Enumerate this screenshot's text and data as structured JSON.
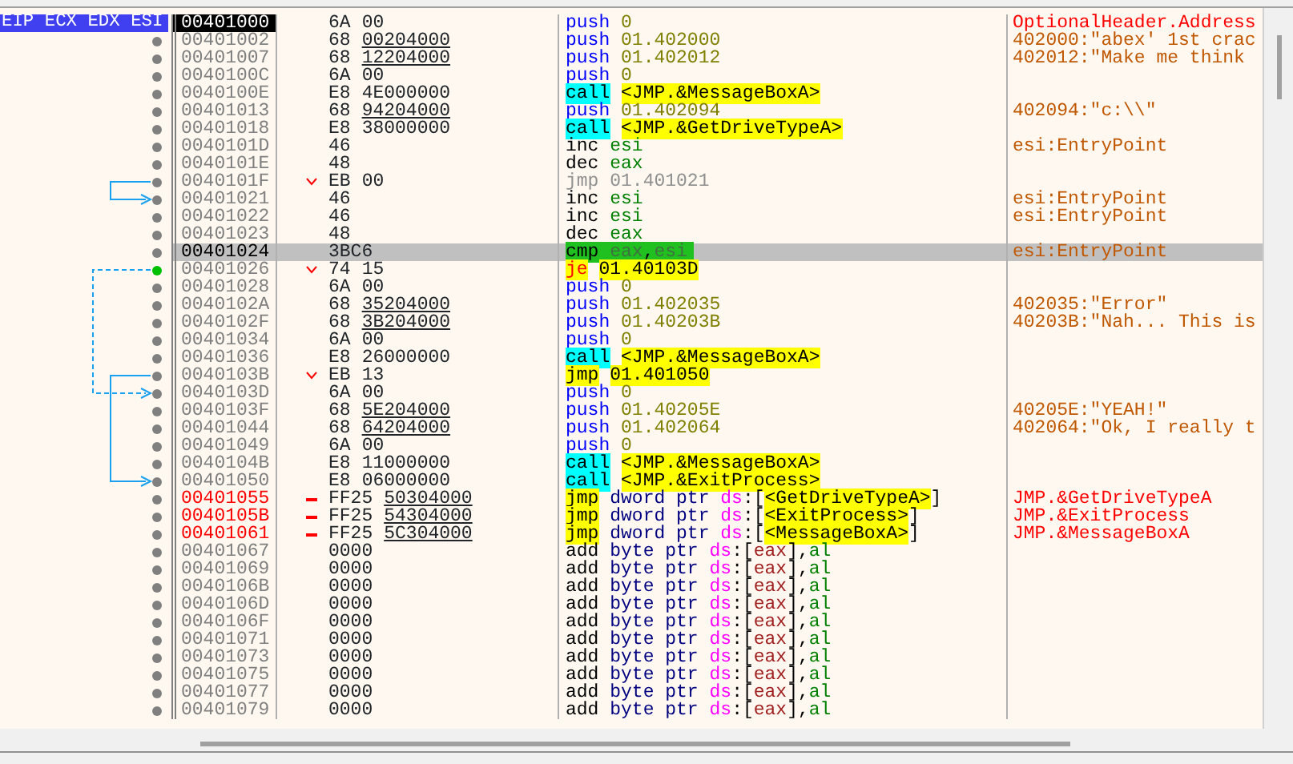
{
  "rows": [
    {
      "address": {
        "text": "00401000",
        "kind": "eip"
      },
      "selected": false,
      "register_tags": "EIP ECX EDX ESI",
      "opcode": "6A",
      "operand": "00",
      "underlined": false,
      "mnemonic": {
        "text": "push",
        "kind": "push"
      },
      "operands": [
        {
          "text": "0",
          "kind": "num"
        }
      ],
      "highlight": false,
      "comment": {
        "text": "OptionalHeader.Address",
        "kind": "symbol"
      }
    },
    {
      "address": {
        "text": "00401002",
        "kind": "normal"
      },
      "selected": false,
      "dot": {
        "color": "#808080"
      },
      "opcode": "68",
      "operand": "00204000",
      "underlined": true,
      "mnemonic": {
        "text": "push",
        "kind": "push"
      },
      "operands": [
        {
          "text": "01.402000",
          "kind": "num"
        }
      ],
      "highlight": false,
      "comment": {
        "text": "402000:\"abex' 1st crac",
        "kind": "string"
      }
    },
    {
      "address": {
        "text": "00401007",
        "kind": "normal"
      },
      "selected": false,
      "dot": {
        "color": "#808080"
      },
      "opcode": "68",
      "operand": "12204000",
      "underlined": true,
      "mnemonic": {
        "text": "push",
        "kind": "push"
      },
      "operands": [
        {
          "text": "01.402012",
          "kind": "num"
        }
      ],
      "highlight": false,
      "comment": {
        "text": "402012:\"Make me think",
        "kind": "string"
      }
    },
    {
      "address": {
        "text": "0040100C",
        "kind": "normal"
      },
      "selected": false,
      "dot": {
        "color": "#808080"
      },
      "opcode": "6A",
      "operand": "00",
      "underlined": false,
      "mnemonic": {
        "text": "push",
        "kind": "push"
      },
      "operands": [
        {
          "text": "0",
          "kind": "num"
        }
      ],
      "highlight": false
    },
    {
      "address": {
        "text": "0040100E",
        "kind": "normal"
      },
      "selected": false,
      "dot": {
        "color": "#808080"
      },
      "opcode": "E8",
      "operand": "4E000000",
      "underlined": false,
      "mnemonic": {
        "text": "call",
        "kind": "call"
      },
      "operands": [
        {
          "text": "<JMP.&MessageBoxA>",
          "kind": "label"
        }
      ],
      "highlight": false
    },
    {
      "address": {
        "text": "00401013",
        "kind": "normal"
      },
      "selected": false,
      "dot": {
        "color": "#808080"
      },
      "opcode": "68",
      "operand": "94204000",
      "underlined": true,
      "mnemonic": {
        "text": "push",
        "kind": "push"
      },
      "operands": [
        {
          "text": "01.402094",
          "kind": "num"
        }
      ],
      "highlight": false,
      "comment": {
        "text": "402094:\"c:\\\\\"",
        "kind": "string"
      }
    },
    {
      "address": {
        "text": "00401018",
        "kind": "normal"
      },
      "selected": false,
      "dot": {
        "color": "#808080"
      },
      "opcode": "E8",
      "operand": "38000000",
      "underlined": false,
      "mnemonic": {
        "text": "call",
        "kind": "call"
      },
      "operands": [
        {
          "text": "<JMP.&GetDriveTypeA>",
          "kind": "label"
        }
      ],
      "highlight": false
    },
    {
      "address": {
        "text": "0040101D",
        "kind": "normal"
      },
      "selected": false,
      "dot": {
        "color": "#808080"
      },
      "opcode": "46",
      "mnemonic": {
        "text": "inc",
        "kind": "plain"
      },
      "operands": [
        {
          "text": "esi",
          "kind": "reg"
        }
      ],
      "highlight": false,
      "comment": {
        "text": "esi:EntryPoint",
        "kind": "string"
      }
    },
    {
      "address": {
        "text": "0040101E",
        "kind": "normal"
      },
      "selected": false,
      "dot": {
        "color": "#808080"
      },
      "opcode": "48",
      "mnemonic": {
        "text": "dec",
        "kind": "plain"
      },
      "operands": [
        {
          "text": "eax",
          "kind": "reg"
        }
      ],
      "highlight": false
    },
    {
      "address": {
        "text": "0040101F",
        "kind": "normal"
      },
      "selected": false,
      "dot": {
        "color": "#808080"
      },
      "branch": {
        "kind": "jump"
      },
      "arrow": {
        "kind": "start"
      },
      "opcode": "EB",
      "operand": "00",
      "underlined": false,
      "mnemonic": {
        "text": "jmp",
        "kind": "dim"
      },
      "operands": [
        {
          "text": "01.401021",
          "kind": "dim"
        }
      ],
      "highlight": false
    },
    {
      "address": {
        "text": "00401021",
        "kind": "normal"
      },
      "selected": false,
      "dot": {
        "color": "#808080"
      },
      "arrow": {
        "kind": "end"
      },
      "opcode": "46",
      "mnemonic": {
        "text": "inc",
        "kind": "plain"
      },
      "operands": [
        {
          "text": "esi",
          "kind": "reg"
        }
      ],
      "highlight": false,
      "comment": {
        "text": "esi:EntryPoint",
        "kind": "string"
      }
    },
    {
      "address": {
        "text": "00401022",
        "kind": "normal"
      },
      "selected": false,
      "dot": {
        "color": "#808080"
      },
      "opcode": "46",
      "mnemonic": {
        "text": "inc",
        "kind": "plain"
      },
      "operands": [
        {
          "text": "esi",
          "kind": "reg"
        }
      ],
      "highlight": false,
      "comment": {
        "text": "esi:EntryPoint",
        "kind": "string"
      }
    },
    {
      "address": {
        "text": "00401023",
        "kind": "normal"
      },
      "selected": false,
      "dot": {
        "color": "#808080"
      },
      "opcode": "48",
      "mnemonic": {
        "text": "dec",
        "kind": "plain"
      },
      "operands": [
        {
          "text": "eax",
          "kind": "reg"
        }
      ],
      "highlight": false
    },
    {
      "address": {
        "text": "00401024",
        "kind": "normal"
      },
      "selected": true,
      "dot": {
        "color": "#808080"
      },
      "opcode": "3BC6",
      "mnemonic": {
        "text": "cmp",
        "kind": "plain"
      },
      "operands": [
        {
          "text": "eax",
          "kind": "reg"
        },
        {
          "text": ",",
          "kind": "punct"
        },
        {
          "text": "esi",
          "kind": "reg"
        }
      ],
      "highlight": true,
      "comment": {
        "text": "esi:EntryPoint",
        "kind": "string"
      }
    },
    {
      "address": {
        "text": "00401026",
        "kind": "normal"
      },
      "selected": false,
      "dot": {
        "color": "#00c000"
      },
      "branch": {
        "kind": "jump"
      },
      "arrow": {
        "kind": "dashstart"
      },
      "opcode": "74",
      "operand": "15",
      "underlined": false,
      "mnemonic": {
        "text": "je",
        "kind": "jcc"
      },
      "operands": [
        {
          "text": "01.40103D",
          "kind": "target"
        }
      ],
      "highlight": false
    },
    {
      "address": {
        "text": "00401028",
        "kind": "normal"
      },
      "selected": false,
      "dot": {
        "color": "#808080"
      },
      "opcode": "6A",
      "operand": "00",
      "underlined": false,
      "mnemonic": {
        "text": "push",
        "kind": "push"
      },
      "operands": [
        {
          "text": "0",
          "kind": "num"
        }
      ],
      "highlight": false
    },
    {
      "address": {
        "text": "0040102A",
        "kind": "normal"
      },
      "selected": false,
      "dot": {
        "color": "#808080"
      },
      "opcode": "68",
      "operand": "35204000",
      "underlined": true,
      "mnemonic": {
        "text": "push",
        "kind": "push"
      },
      "operands": [
        {
          "text": "01.402035",
          "kind": "num"
        }
      ],
      "highlight": false,
      "comment": {
        "text": "402035:\"Error\"",
        "kind": "string"
      }
    },
    {
      "address": {
        "text": "0040102F",
        "kind": "normal"
      },
      "selected": false,
      "dot": {
        "color": "#808080"
      },
      "opcode": "68",
      "operand": "3B204000",
      "underlined": true,
      "mnemonic": {
        "text": "push",
        "kind": "push"
      },
      "operands": [
        {
          "text": "01.40203B",
          "kind": "num"
        }
      ],
      "highlight": false,
      "comment": {
        "text": "40203B:\"Nah... This is",
        "kind": "string"
      }
    },
    {
      "address": {
        "text": "00401034",
        "kind": "normal"
      },
      "selected": false,
      "dot": {
        "color": "#808080"
      },
      "opcode": "6A",
      "operand": "00",
      "underlined": false,
      "mnemonic": {
        "text": "push",
        "kind": "push"
      },
      "operands": [
        {
          "text": "0",
          "kind": "num"
        }
      ],
      "highlight": false
    },
    {
      "address": {
        "text": "00401036",
        "kind": "normal"
      },
      "selected": false,
      "dot": {
        "color": "#808080"
      },
      "opcode": "E8",
      "operand": "26000000",
      "underlined": false,
      "mnemonic": {
        "text": "call",
        "kind": "call"
      },
      "operands": [
        {
          "text": "<JMP.&MessageBoxA>",
          "kind": "label"
        }
      ],
      "highlight": false
    },
    {
      "address": {
        "text": "0040103B",
        "kind": "normal"
      },
      "selected": false,
      "dot": {
        "color": "#808080"
      },
      "branch": {
        "kind": "jump"
      },
      "arrow": {
        "kind": "start"
      },
      "opcode": "EB",
      "operand": "13",
      "underlined": false,
      "mnemonic": {
        "text": "jmp",
        "kind": "jmp"
      },
      "operands": [
        {
          "text": "01.401050",
          "kind": "target"
        }
      ],
      "highlight": false
    },
    {
      "address": {
        "text": "0040103D",
        "kind": "normal"
      },
      "selected": false,
      "dot": {
        "color": "#808080"
      },
      "arrow": {
        "kind": "dashend"
      },
      "opcode": "6A",
      "operand": "00",
      "underlined": false,
      "mnemonic": {
        "text": "push",
        "kind": "push"
      },
      "operands": [
        {
          "text": "0",
          "kind": "num"
        }
      ],
      "highlight": false
    },
    {
      "address": {
        "text": "0040103F",
        "kind": "normal"
      },
      "selected": false,
      "dot": {
        "color": "#808080"
      },
      "opcode": "68",
      "operand": "5E204000",
      "underlined": true,
      "mnemonic": {
        "text": "push",
        "kind": "push"
      },
      "operands": [
        {
          "text": "01.40205E",
          "kind": "num"
        }
      ],
      "highlight": false,
      "comment": {
        "text": "40205E:\"YEAH!\"",
        "kind": "string"
      }
    },
    {
      "address": {
        "text": "00401044",
        "kind": "normal"
      },
      "selected": false,
      "dot": {
        "color": "#808080"
      },
      "opcode": "68",
      "operand": "64204000",
      "underlined": true,
      "mnemonic": {
        "text": "push",
        "kind": "push"
      },
      "operands": [
        {
          "text": "01.402064",
          "kind": "num"
        }
      ],
      "highlight": false,
      "comment": {
        "text": "402064:\"Ok, I really t",
        "kind": "string"
      }
    },
    {
      "address": {
        "text": "00401049",
        "kind": "normal"
      },
      "selected": false,
      "dot": {
        "color": "#808080"
      },
      "opcode": "6A",
      "operand": "00",
      "underlined": false,
      "mnemonic": {
        "text": "push",
        "kind": "push"
      },
      "operands": [
        {
          "text": "0",
          "kind": "num"
        }
      ],
      "highlight": false
    },
    {
      "address": {
        "text": "0040104B",
        "kind": "normal"
      },
      "selected": false,
      "dot": {
        "color": "#808080"
      },
      "opcode": "E8",
      "operand": "11000000",
      "underlined": false,
      "mnemonic": {
        "text": "call",
        "kind": "call"
      },
      "operands": [
        {
          "text": "<JMP.&MessageBoxA>",
          "kind": "label"
        }
      ],
      "highlight": false
    },
    {
      "address": {
        "text": "00401050",
        "kind": "normal"
      },
      "selected": false,
      "dot": {
        "color": "#808080"
      },
      "arrow": {
        "kind": "end"
      },
      "opcode": "E8",
      "operand": "06000000",
      "underlined": false,
      "mnemonic": {
        "text": "call",
        "kind": "call"
      },
      "operands": [
        {
          "text": "<JMP.&ExitProcess>",
          "kind": "label"
        }
      ],
      "highlight": false
    },
    {
      "address": {
        "text": "00401055",
        "kind": "import"
      },
      "selected": false,
      "dot": {
        "color": "#808080"
      },
      "branch": {
        "kind": "thunk"
      },
      "opcode": "FF25",
      "operand": "50304000",
      "underlined": true,
      "mnemonic": {
        "text": "jmp",
        "kind": "jmp"
      },
      "operands": [
        {
          "text": "dword ptr ",
          "kind": "size"
        },
        {
          "text": "ds",
          "kind": "seg"
        },
        {
          "text": ":[",
          "kind": "punct"
        },
        {
          "text": "<GetDriveTypeA>",
          "kind": "label"
        },
        {
          "text": "]",
          "kind": "punct"
        }
      ],
      "highlight": false,
      "comment": {
        "text": "JMP.&GetDriveTypeA",
        "kind": "symbol"
      }
    },
    {
      "address": {
        "text": "0040105B",
        "kind": "import"
      },
      "selected": false,
      "dot": {
        "color": "#808080"
      },
      "branch": {
        "kind": "thunk"
      },
      "opcode": "FF25",
      "operand": "54304000",
      "underlined": true,
      "mnemonic": {
        "text": "jmp",
        "kind": "jmp"
      },
      "operands": [
        {
          "text": "dword ptr ",
          "kind": "size"
        },
        {
          "text": "ds",
          "kind": "seg"
        },
        {
          "text": ":[",
          "kind": "punct"
        },
        {
          "text": "<ExitProcess>",
          "kind": "label"
        },
        {
          "text": "]",
          "kind": "punct"
        }
      ],
      "highlight": false,
      "comment": {
        "text": "JMP.&ExitProcess",
        "kind": "symbol"
      }
    },
    {
      "address": {
        "text": "00401061",
        "kind": "import"
      },
      "selected": false,
      "dot": {
        "color": "#808080"
      },
      "branch": {
        "kind": "thunk"
      },
      "opcode": "FF25",
      "operand": "5C304000",
      "underlined": true,
      "mnemonic": {
        "text": "jmp",
        "kind": "jmp"
      },
      "operands": [
        {
          "text": "dword ptr ",
          "kind": "size"
        },
        {
          "text": "ds",
          "kind": "seg"
        },
        {
          "text": ":[",
          "kind": "punct"
        },
        {
          "text": "<MessageBoxA>",
          "kind": "label"
        },
        {
          "text": "]",
          "kind": "punct"
        }
      ],
      "highlight": false,
      "comment": {
        "text": "JMP.&MessageBoxA",
        "kind": "symbol"
      }
    },
    {
      "address": {
        "text": "00401067",
        "kind": "normal"
      },
      "selected": false,
      "dot": {
        "color": "#808080"
      },
      "opcode": "0000",
      "mnemonic": {
        "text": "add",
        "kind": "plain"
      },
      "operands": [
        {
          "text": "byte ptr ",
          "kind": "size"
        },
        {
          "text": "ds",
          "kind": "seg"
        },
        {
          "text": ":[",
          "kind": "punct"
        },
        {
          "text": "eax",
          "kind": "mem"
        },
        {
          "text": "],",
          "kind": "punct"
        },
        {
          "text": "al",
          "kind": "reg"
        }
      ],
      "highlight": false
    },
    {
      "address": {
        "text": "00401069",
        "kind": "normal"
      },
      "selected": false,
      "dot": {
        "color": "#808080"
      },
      "opcode": "0000",
      "mnemonic": {
        "text": "add",
        "kind": "plain"
      },
      "operands": [
        {
          "text": "byte ptr ",
          "kind": "size"
        },
        {
          "text": "ds",
          "kind": "seg"
        },
        {
          "text": ":[",
          "kind": "punct"
        },
        {
          "text": "eax",
          "kind": "mem"
        },
        {
          "text": "],",
          "kind": "punct"
        },
        {
          "text": "al",
          "kind": "reg"
        }
      ],
      "highlight": false
    },
    {
      "address": {
        "text": "0040106B",
        "kind": "normal"
      },
      "selected": false,
      "dot": {
        "color": "#808080"
      },
      "opcode": "0000",
      "mnemonic": {
        "text": "add",
        "kind": "plain"
      },
      "operands": [
        {
          "text": "byte ptr ",
          "kind": "size"
        },
        {
          "text": "ds",
          "kind": "seg"
        },
        {
          "text": ":[",
          "kind": "punct"
        },
        {
          "text": "eax",
          "kind": "mem"
        },
        {
          "text": "],",
          "kind": "punct"
        },
        {
          "text": "al",
          "kind": "reg"
        }
      ],
      "highlight": false
    },
    {
      "address": {
        "text": "0040106D",
        "kind": "normal"
      },
      "selected": false,
      "dot": {
        "color": "#808080"
      },
      "opcode": "0000",
      "mnemonic": {
        "text": "add",
        "kind": "plain"
      },
      "operands": [
        {
          "text": "byte ptr ",
          "kind": "size"
        },
        {
          "text": "ds",
          "kind": "seg"
        },
        {
          "text": ":[",
          "kind": "punct"
        },
        {
          "text": "eax",
          "kind": "mem"
        },
        {
          "text": "],",
          "kind": "punct"
        },
        {
          "text": "al",
          "kind": "reg"
        }
      ],
      "highlight": false
    },
    {
      "address": {
        "text": "0040106F",
        "kind": "normal"
      },
      "selected": false,
      "dot": {
        "color": "#808080"
      },
      "opcode": "0000",
      "mnemonic": {
        "text": "add",
        "kind": "plain"
      },
      "operands": [
        {
          "text": "byte ptr ",
          "kind": "size"
        },
        {
          "text": "ds",
          "kind": "seg"
        },
        {
          "text": ":[",
          "kind": "punct"
        },
        {
          "text": "eax",
          "kind": "mem"
        },
        {
          "text": "],",
          "kind": "punct"
        },
        {
          "text": "al",
          "kind": "reg"
        }
      ],
      "highlight": false
    },
    {
      "address": {
        "text": "00401071",
        "kind": "normal"
      },
      "selected": false,
      "dot": {
        "color": "#808080"
      },
      "opcode": "0000",
      "mnemonic": {
        "text": "add",
        "kind": "plain"
      },
      "operands": [
        {
          "text": "byte ptr ",
          "kind": "size"
        },
        {
          "text": "ds",
          "kind": "seg"
        },
        {
          "text": ":[",
          "kind": "punct"
        },
        {
          "text": "eax",
          "kind": "mem"
        },
        {
          "text": "],",
          "kind": "punct"
        },
        {
          "text": "al",
          "kind": "reg"
        }
      ],
      "highlight": false
    },
    {
      "address": {
        "text": "00401073",
        "kind": "normal"
      },
      "selected": false,
      "dot": {
        "color": "#808080"
      },
      "opcode": "0000",
      "mnemonic": {
        "text": "add",
        "kind": "plain"
      },
      "operands": [
        {
          "text": "byte ptr ",
          "kind": "size"
        },
        {
          "text": "ds",
          "kind": "seg"
        },
        {
          "text": ":[",
          "kind": "punct"
        },
        {
          "text": "eax",
          "kind": "mem"
        },
        {
          "text": "],",
          "kind": "punct"
        },
        {
          "text": "al",
          "kind": "reg"
        }
      ],
      "highlight": false
    },
    {
      "address": {
        "text": "00401075",
        "kind": "normal"
      },
      "selected": false,
      "dot": {
        "color": "#808080"
      },
      "opcode": "0000",
      "mnemonic": {
        "text": "add",
        "kind": "plain"
      },
      "operands": [
        {
          "text": "byte ptr ",
          "kind": "size"
        },
        {
          "text": "ds",
          "kind": "seg"
        },
        {
          "text": ":[",
          "kind": "punct"
        },
        {
          "text": "eax",
          "kind": "mem"
        },
        {
          "text": "],",
          "kind": "punct"
        },
        {
          "text": "al",
          "kind": "reg"
        }
      ],
      "highlight": false
    },
    {
      "address": {
        "text": "00401077",
        "kind": "normal"
      },
      "selected": false,
      "dot": {
        "color": "#808080"
      },
      "opcode": "0000",
      "mnemonic": {
        "text": "add",
        "kind": "plain"
      },
      "operands": [
        {
          "text": "byte ptr ",
          "kind": "size"
        },
        {
          "text": "ds",
          "kind": "seg"
        },
        {
          "text": ":[",
          "kind": "punct"
        },
        {
          "text": "eax",
          "kind": "mem"
        },
        {
          "text": "],",
          "kind": "punct"
        },
        {
          "text": "al",
          "kind": "reg"
        }
      ],
      "highlight": false
    },
    {
      "address": {
        "text": "00401079",
        "kind": "normal"
      },
      "selected": false,
      "dot": {
        "color": "#808080"
      },
      "opcode": "0000",
      "mnemonic": {
        "text": "add",
        "kind": "plain"
      },
      "operands": [
        {
          "text": "byte ptr ",
          "kind": "size"
        },
        {
          "text": "ds",
          "kind": "seg"
        },
        {
          "text": ":[",
          "kind": "punct"
        },
        {
          "text": "eax",
          "kind": "mem"
        },
        {
          "text": "],",
          "kind": "punct"
        },
        {
          "text": "al",
          "kind": "reg"
        }
      ],
      "highlight": false
    }
  ]
}
